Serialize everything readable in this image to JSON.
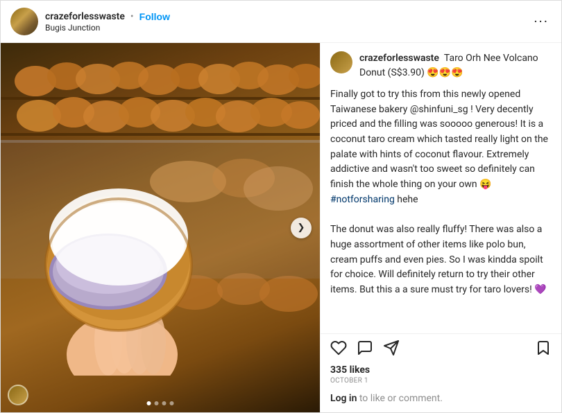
{
  "header": {
    "username": "crazeforlesswaste",
    "dot": "•",
    "follow_label": "Follow",
    "location": "Bugis Junction",
    "more_icon": "•••"
  },
  "post": {
    "image_alt": "Taro Orh Nee Volcano Donut from Shinfuni bakery",
    "nav_arrow": "❯",
    "dots": [
      true,
      false,
      false,
      false
    ]
  },
  "caption": {
    "username": "crazeforlesswaste",
    "title": "Taro Orh Nee Volcano Donut (S$3.90) 😍😍😍",
    "body": "Finally got to try this from this newly opened Taiwanese bakery @shinfuni_sg ! Very decently priced and the filling was sooooo generous! It is a coconut taro cream which tasted really light on the palate with hints of coconut flavour. Extremely addictive and wasn't too sweet so definitely can finish the whole thing on your own 😝 #notforsharing hehe\n\nThe donut was also really fluffy! There was also a huge assortment of other items like polo bun, cream puffs and even pies. So I was kindda spoilt for choice. Will definitely return to try their other items. But this a a sure must try for taro lovers! 💜",
    "hashtag": "#notforsharing"
  },
  "actions": {
    "like_icon": "heart",
    "comment_icon": "comment",
    "share_icon": "share",
    "bookmark_icon": "bookmark"
  },
  "meta": {
    "likes": "335 likes",
    "date": "OCTOBER 1",
    "login_text": "Log in",
    "login_suffix": " to like or comment."
  }
}
